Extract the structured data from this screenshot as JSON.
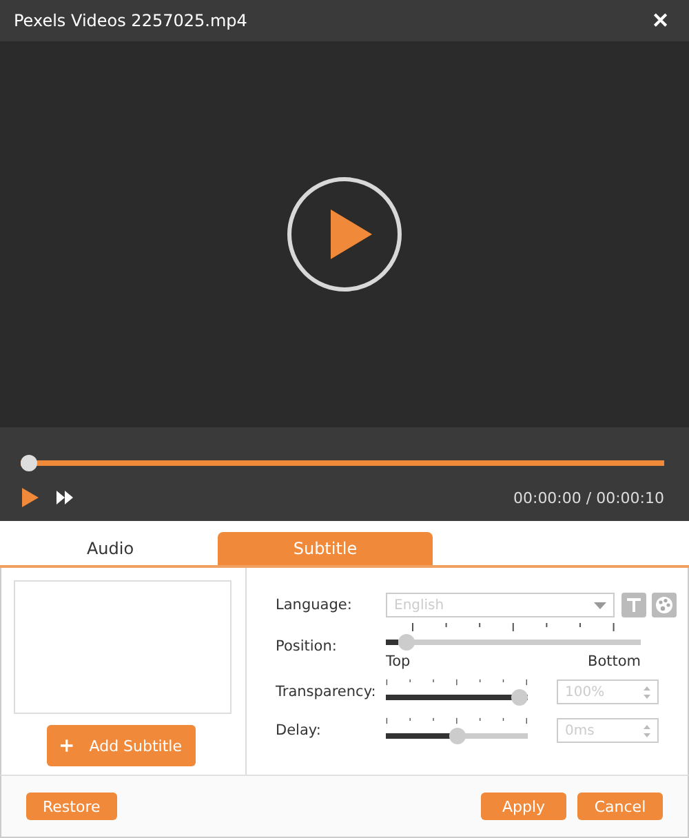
{
  "window": {
    "title": "Pexels Videos 2257025.mp4",
    "close": "✕"
  },
  "player": {
    "progress": {
      "level": 0
    },
    "time": "00:00:00 / 00:00:10"
  },
  "tabs": [
    {
      "label": "Audio",
      "selected": false
    },
    {
      "label": "Subtitle",
      "selected": true
    }
  ],
  "subtitle": {
    "add_button": "Add Subtitle",
    "settings": [
      {
        "kind": "select",
        "label": "Language:",
        "value": "English",
        "disabled": true
      },
      {
        "kind": "slider",
        "label": "Position:",
        "level": 0.05,
        "min_label": "Top",
        "max_label": "Bottom"
      },
      {
        "kind": "slider_field",
        "label": "Transparency:",
        "level": 1,
        "value": "100%",
        "disabled": true
      },
      {
        "kind": "slider_field",
        "label": "Delay:",
        "level": 0.5,
        "value": "0ms",
        "disabled": true
      }
    ]
  },
  "buttons": {
    "left": [
      "Restore"
    ],
    "right": [
      "Apply",
      "Cancel"
    ]
  }
}
